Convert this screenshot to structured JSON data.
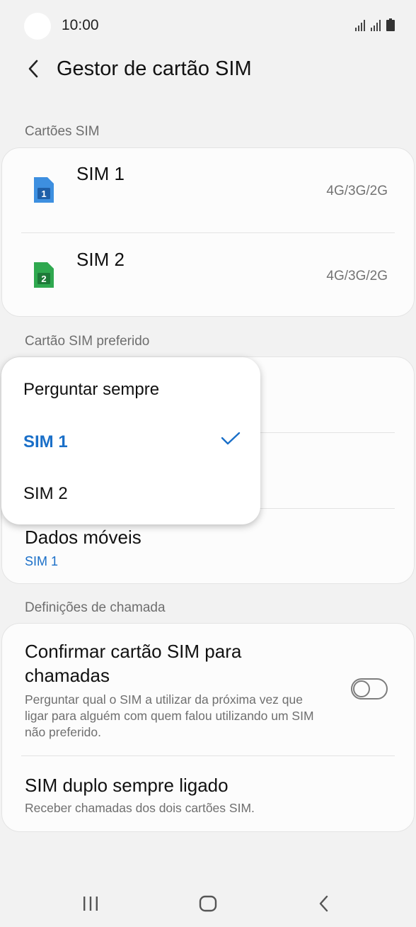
{
  "status_bar": {
    "time": "10:00",
    "icons": [
      "signal-sim1-icon",
      "signal-sim2-icon",
      "battery-icon"
    ]
  },
  "header": {
    "back_icon": "chevron-left-icon",
    "title": "Gestor de cartão SIM"
  },
  "sim_cards": {
    "section_label": "Cartões SIM",
    "items": [
      {
        "name": "SIM 1",
        "network": "4G/3G/2G",
        "icon": "sim-card-1-icon",
        "color": "#3d8fe0"
      },
      {
        "name": "SIM 2",
        "network": "4G/3G/2G",
        "icon": "sim-card-2-icon",
        "color": "#2fa84f"
      }
    ]
  },
  "preferred_sim": {
    "section_label": "Cartão SIM preferido",
    "mobile_data": {
      "title": "Dados móveis",
      "value": "SIM 1"
    }
  },
  "popup": {
    "options": [
      "Perguntar sempre",
      "SIM 1",
      "SIM 2"
    ],
    "selected": "SIM 1"
  },
  "call_settings": {
    "section_label": "Definições de chamada",
    "confirm_sim": {
      "title": "Confirmar cartão SIM para chamadas",
      "description": "Perguntar qual o SIM a utilizar da próxima vez que ligar para alguém com quem falou utilizando um SIM não preferido.",
      "enabled": false
    },
    "dual_sim": {
      "title": "SIM duplo sempre ligado",
      "description": "Receber chamadas dos dois cartões SIM."
    }
  },
  "nav_bar": {
    "recents_icon": "recents-icon",
    "home_icon": "home-icon",
    "back_icon": "back-icon"
  },
  "colors": {
    "accent": "#1a6fc8",
    "background": "#f2f2f2"
  }
}
